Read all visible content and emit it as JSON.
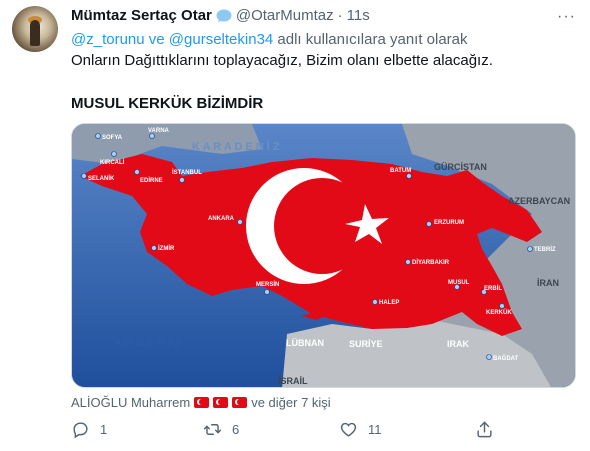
{
  "tweet": {
    "author_name": "Mümtaz Sertaç Otar",
    "author_handle": "@OtarMumtaz",
    "separator": "·",
    "time": "11s",
    "more": "···",
    "reply_to": {
      "mention1": "@z_torunu",
      "connector": " ve ",
      "mention2": "@gurseltekin34",
      "suffix": " adlı kullanıcılara yanıt olarak"
    },
    "text_line1": "Onların Dağıttıklarını toplayacağız, Bizim olanı elbette alacağız.",
    "text_line2": "MUSUL KERKÜK BİZİMDİR"
  },
  "map": {
    "labels": {
      "karadeniz": "K A R A D E N İ Z",
      "akdeniz": "A K D E N İ Z",
      "gurcistan": "GÜRCİSTAN",
      "azerbaycan": "AZERBAYCAN",
      "iran": "İRAN",
      "irak": "IRAK",
      "suriye": "SURİYE",
      "lubnan": "LÜBNAN",
      "israil": "İSRAİL"
    },
    "cities": {
      "sofya": "SOFYA",
      "varna": "VARNA",
      "kircali": "KIRCALİ",
      "selanik": "SELANİK",
      "edirne": "EDİRNE",
      "istanbul": "İSTANBUL",
      "batum": "BATUM",
      "ankara": "ANKARA",
      "erzurum": "ERZURUM",
      "izmir": "İZMİR",
      "tebriz": "TEBRİZ",
      "diyarbakir": "DİYARBAKIR",
      "musul": "MUSUL",
      "erbil": "ERBİL",
      "kerkuk": "KERKÜK",
      "mersin": "MERSİN",
      "halep": "HALEP",
      "bagdat": "BAĞDAT"
    }
  },
  "liked_by": {
    "name": "ALİOĞLU Muharrem",
    "suffix": "ve diğer 7 kişi"
  },
  "actions": {
    "reply_count": "1",
    "retweet_count": "6",
    "like_count": "11"
  },
  "colors": {
    "accent": "#1d9bf0",
    "muted": "#536471",
    "text": "#0f1419",
    "map_red": "#e30a17",
    "sea_blue": "#2a5fae"
  }
}
